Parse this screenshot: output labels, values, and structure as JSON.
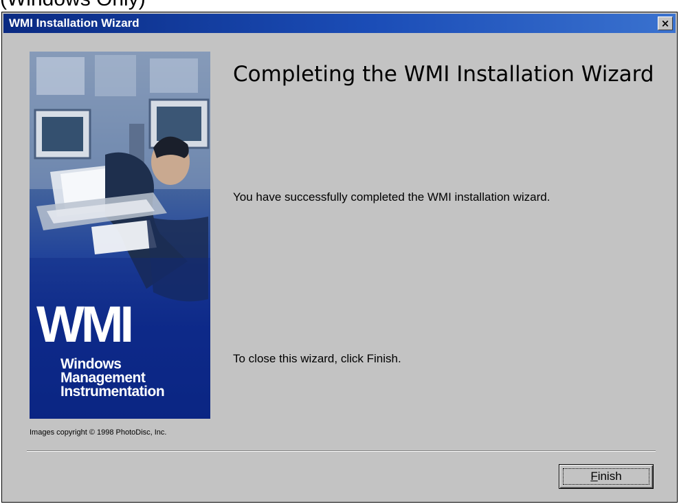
{
  "top_strip": {
    "text": "(Windows Only)"
  },
  "window": {
    "title": "WMI Installation Wizard",
    "close_symbol": "×"
  },
  "side_image": {
    "logo": "WMI",
    "lines": [
      "Windows",
      "Management",
      "Instrumentation"
    ],
    "copyright": "Images copyright © 1998 PhotoDisc, Inc."
  },
  "content": {
    "heading": "Completing the WMI Installation Wizard",
    "message": "You have successfully completed the WMI installation wizard.",
    "instruction": "To close this wizard, click Finish."
  },
  "buttons": {
    "finish": {
      "mnemonic": "F",
      "rest": "inish"
    }
  },
  "colors": {
    "dialog_bg": "#c3c3c3",
    "titlebar_start": "#0a2a82",
    "titlebar_end": "#3a72cf",
    "banner_blue": "#0b2683"
  }
}
